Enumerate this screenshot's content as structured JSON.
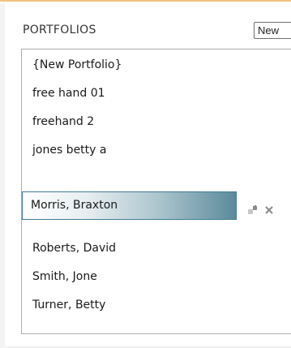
{
  "header": {
    "title": "PORTFOLIOS",
    "new_label": "New"
  },
  "portfolios": [
    {
      "label": "{New Portfolio}"
    },
    {
      "label": "free hand 01"
    },
    {
      "label": "freehand 2"
    },
    {
      "label": "jones betty a"
    },
    {
      "label": "Morris, Braxton",
      "selected": true
    },
    {
      "label": "Roberts, David"
    },
    {
      "label": "Smith, Jone"
    },
    {
      "label": "Turner, Betty"
    }
  ],
  "selected_row_actions": {
    "icons": [
      "restore-icon",
      "close-icon"
    ]
  },
  "colors": {
    "accent_top_border": "#f2c27c",
    "selection_border": "#3f7e95",
    "selection_gradient_end": "#5b8a9b"
  }
}
